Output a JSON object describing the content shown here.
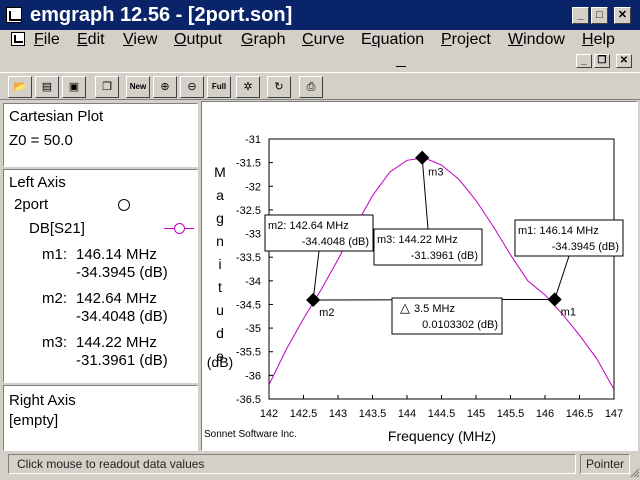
{
  "window": {
    "title": "emgraph 12.56 - [2port.son]",
    "buttons": {
      "minimize": "_",
      "maximize": "□",
      "close": "✕"
    }
  },
  "menubar": {
    "items": [
      {
        "id": "file",
        "u": "F",
        "rest": "ile"
      },
      {
        "id": "edit",
        "u": "E",
        "rest": "dit"
      },
      {
        "id": "view",
        "u": "V",
        "rest": "iew"
      },
      {
        "id": "output",
        "u": "O",
        "rest": "utput"
      },
      {
        "id": "graph",
        "u": "G",
        "rest": "raph"
      },
      {
        "id": "curve",
        "u": "C",
        "rest": "urve"
      },
      {
        "id": "equation",
        "pre": "E",
        "u": "q",
        "rest": "uation"
      },
      {
        "id": "project",
        "u": "P",
        "rest": "roject"
      },
      {
        "id": "window",
        "u": "W",
        "rest": "indow"
      },
      {
        "id": "help",
        "u": "H",
        "rest": "elp"
      }
    ]
  },
  "toolbar": {
    "buttons": [
      {
        "id": "open",
        "icon": "open-folder-icon",
        "glyph": "📂"
      },
      {
        "id": "save-all",
        "icon": "save-all-icon",
        "glyph": "▤"
      },
      {
        "id": "save",
        "icon": "floppy-disk-icon",
        "glyph": "▣"
      },
      {
        "id": "copy",
        "icon": "copy-icon",
        "glyph": "❐"
      },
      {
        "id": "new",
        "icon": "new-graph-icon",
        "glyph": "New"
      },
      {
        "id": "zoom-in",
        "icon": "zoom-in-icon",
        "glyph": "⊕"
      },
      {
        "id": "zoom-out",
        "icon": "zoom-out-icon",
        "glyph": "⊖"
      },
      {
        "id": "zoom-full",
        "icon": "zoom-full-icon",
        "glyph": "Full"
      },
      {
        "id": "settings",
        "icon": "gear-icon",
        "glyph": "✲"
      },
      {
        "id": "refresh",
        "icon": "refresh-icon",
        "glyph": "↻"
      },
      {
        "id": "print",
        "icon": "printer-icon",
        "glyph": "⎙"
      }
    ]
  },
  "left_panel": {
    "plot_type": "Cartesian Plot",
    "z0": "Z0 = 50.0",
    "left_axis": {
      "header": "Left Axis",
      "file": "2port",
      "curve": "DB[S21]",
      "markers": [
        {
          "name": "m1:",
          "freq": "146.14 MHz",
          "value": "-34.3945 (dB)"
        },
        {
          "name": "m2:",
          "freq": "142.64 MHz",
          "value": "-34.4048 (dB)"
        },
        {
          "name": "m3:",
          "freq": "144.22 MHz",
          "value": "-31.3961 (dB)"
        }
      ]
    },
    "right_axis": {
      "header": "Right Axis",
      "value": "[empty]"
    }
  },
  "chart_data": {
    "type": "line",
    "xlabel": "Frequency (MHz)",
    "ylabel_letters": [
      "M",
      "a",
      "g",
      "n",
      "i",
      "t",
      "u",
      "d",
      "e"
    ],
    "ylabel_unit": "(dB)",
    "xlim": [
      142,
      147
    ],
    "ylim": [
      -36.5,
      -31
    ],
    "xticks": [
      "142",
      "142.5",
      "143",
      "143.5",
      "144",
      "144.5",
      "145",
      "145.5",
      "146",
      "146.5",
      "147"
    ],
    "yticks": [
      "-31",
      "-31.5",
      "-32",
      "-32.5",
      "-33",
      "-33.5",
      "-34",
      "-34.5",
      "-35",
      "-35.5",
      "-36",
      "-36.5"
    ],
    "series": [
      {
        "color": "#c000c0",
        "x": [
          142,
          142.25,
          142.5,
          142.75,
          143,
          143.25,
          143.5,
          143.75,
          144,
          144.25,
          144.5,
          144.75,
          145,
          145.25,
          145.5,
          145.75,
          146,
          146.25,
          146.5,
          146.75,
          147
        ],
        "y": [
          -36.2,
          -35.45,
          -34.8,
          -34.2,
          -33.55,
          -32.85,
          -32.2,
          -31.7,
          -31.45,
          -31.4,
          -31.55,
          -31.85,
          -32.3,
          -32.85,
          -33.45,
          -34.0,
          -34.3,
          -34.7,
          -35.15,
          -35.65,
          -36.3
        ]
      }
    ],
    "markers": [
      {
        "name": "m1",
        "x": 146.14,
        "y": -34.3945
      },
      {
        "name": "m2",
        "x": 142.64,
        "y": -34.4048
      },
      {
        "name": "m3",
        "x": 144.22,
        "y": -31.3961
      }
    ],
    "callouts": [
      {
        "target": "m2",
        "line1": "m2: 142.64 MHz",
        "line2": "-34.4048  (dB)"
      },
      {
        "target": "m3",
        "line1": "m3: 144.22 MHz",
        "line2": "-31.3961  (dB)"
      },
      {
        "target": "m1",
        "line1": "m1: 146.14 MHz",
        "line2": "-34.3945  (dB)"
      }
    ],
    "delta": {
      "line1": "3.5 MHz",
      "line2": "0.0103302  (dB)",
      "symbol": "△"
    },
    "credit": "Sonnet Software Inc."
  },
  "status": {
    "message": "Click mouse to readout data values",
    "mode": "Pointer"
  }
}
